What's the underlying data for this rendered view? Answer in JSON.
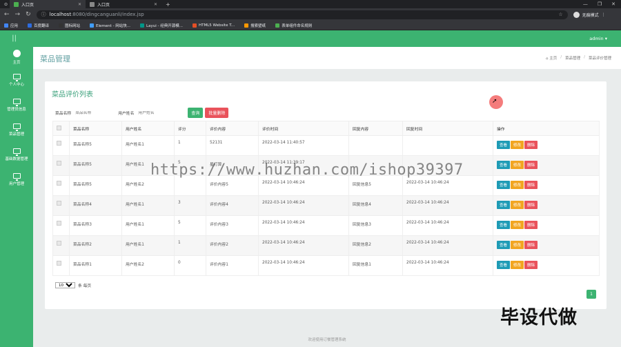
{
  "browser": {
    "tabs": [
      {
        "label": "入口页",
        "active": true
      },
      {
        "label": "入口页",
        "active": false
      }
    ],
    "new_tab": "+",
    "url_host": "localhost",
    "url_path": ":8080/dingcanguanli/index.jsp",
    "profile_label": "无痕模式",
    "window_controls": [
      "—",
      "❐",
      "✕"
    ],
    "bookmarks": [
      {
        "label": "应用",
        "color": "#4285f4"
      },
      {
        "label": "百度翻译",
        "color": "#2d6cdf"
      },
      {
        "label": "图标网站",
        "color": "#333333"
      },
      {
        "label": "Element - 网站快...",
        "color": "#409eff"
      },
      {
        "label": "Layui - 经典开源模...",
        "color": "#009688"
      },
      {
        "label": "HTML5 Website T...",
        "color": "#e34f26"
      },
      {
        "label": "搜索壁纸",
        "color": "#ff9800"
      },
      {
        "label": "表单组件命名规则",
        "color": "#4caf50"
      }
    ]
  },
  "app": {
    "logo": "||",
    "user": "admin ▾",
    "accent": "#3cb371",
    "sidebar": [
      {
        "label": "主页",
        "icon": "gauge-icon"
      },
      {
        "label": "个人中心",
        "icon": "monitor-icon"
      },
      {
        "label": "管理员信息",
        "icon": "monitor-icon"
      },
      {
        "label": "菜品管理",
        "icon": "monitor-icon"
      },
      {
        "label": "基础数据管理",
        "icon": "monitor-icon"
      },
      {
        "label": "用户管理",
        "icon": "monitor-icon"
      }
    ],
    "page_title": "菜品管理",
    "breadcrumb": [
      "⌂ 主页",
      "/",
      "菜品管理",
      "/",
      "菜品评价管理"
    ],
    "card_title": "菜品评价列表",
    "filter": {
      "dish_label": "菜品名称",
      "dish_placeholder": "菜品名称",
      "user_label": "用户姓名",
      "user_placeholder": "用户姓名",
      "query_button": "查询",
      "batch_delete_button": "批量删除"
    },
    "table": {
      "headers": [
        "菜品名称",
        "用户姓名",
        "评分",
        "评价内容",
        "评价时间",
        "回复内容",
        "回复时间",
        "操作"
      ],
      "rows": [
        {
          "dish": "菜品名称5",
          "user": "用户姓名1",
          "score": "1",
          "content": "52131",
          "time": "2022-03-14 11:40:57",
          "reply": "",
          "reply_time": ""
        },
        {
          "dish": "菜品名称5",
          "user": "用户姓名1",
          "score": "5",
          "content": "星打算",
          "time": "2022-03-14 11:39:17",
          "reply": "",
          "reply_time": ""
        },
        {
          "dish": "菜品名称5",
          "user": "用户姓名2",
          "score": "",
          "content": "评价内容5",
          "time": "2022-03-14 10:46:24",
          "reply": "回复信息5",
          "reply_time": "2022-03-14 10:46:24"
        },
        {
          "dish": "菜品名称4",
          "user": "用户姓名1",
          "score": "3",
          "content": "评价内容4",
          "time": "2022-03-14 10:46:24",
          "reply": "回复信息4",
          "reply_time": "2022-03-14 10:46:24"
        },
        {
          "dish": "菜品名称3",
          "user": "用户姓名1",
          "score": "5",
          "content": "评价内容3",
          "time": "2022-03-14 10:46:24",
          "reply": "回复信息3",
          "reply_time": "2022-03-14 10:46:24"
        },
        {
          "dish": "菜品名称2",
          "user": "用户姓名1",
          "score": "1",
          "content": "评价内容2",
          "time": "2022-03-14 10:46:24",
          "reply": "回复信息2",
          "reply_time": "2022-03-14 10:46:24"
        },
        {
          "dish": "菜品名称1",
          "user": "用户姓名2",
          "score": "0",
          "content": "评价内容1",
          "time": "2022-03-14 10:46:24",
          "reply": "回复信息1",
          "reply_time": "2022-03-14 10:46:24"
        }
      ],
      "actions": {
        "view": "查看",
        "edit": "修改",
        "delete": "删除"
      }
    },
    "page_size": {
      "value": "10",
      "options": [
        "10"
      ],
      "suffix": "条 每页"
    },
    "current_page": "1",
    "footer": "欢迎使用订餐管理系统"
  },
  "overlay": {
    "watermark": "https://www.huzhan.com/ishop39397",
    "corner_text": "毕设代做"
  }
}
